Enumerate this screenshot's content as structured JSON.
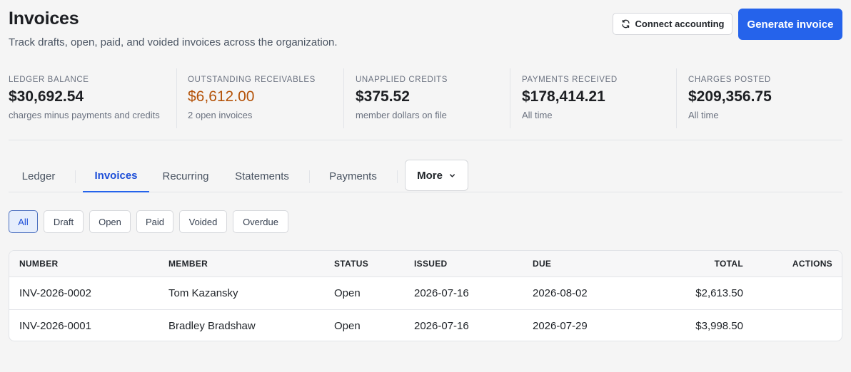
{
  "header": {
    "title": "Invoices",
    "subtitle": "Track drafts, open, paid, and voided invoices across the organization.",
    "connect_label": "Connect accounting",
    "generate_label": "Generate invoice"
  },
  "stats": [
    {
      "label": "LEDGER BALANCE",
      "value": "$30,692.54",
      "sub": "charges minus payments and credits"
    },
    {
      "label": "OUTSTANDING RECEIVABLES",
      "value": "$6,612.00",
      "sub": "2 open invoices",
      "value_color": "#b45309"
    },
    {
      "label": "UNAPPLIED CREDITS",
      "value": "$375.52",
      "sub": "member dollars on file"
    },
    {
      "label": "PAYMENTS RECEIVED",
      "value": "$178,414.21",
      "sub": "All time"
    },
    {
      "label": "CHARGES POSTED",
      "value": "$209,356.75",
      "sub": "All time"
    }
  ],
  "tabs": [
    {
      "label": "Ledger"
    },
    {
      "label": "Invoices",
      "active": true
    },
    {
      "label": "Recurring"
    },
    {
      "label": "Statements"
    },
    {
      "label": "Payments"
    }
  ],
  "more_label": "More",
  "filters": [
    {
      "label": "All",
      "active": true
    },
    {
      "label": "Draft"
    },
    {
      "label": "Open"
    },
    {
      "label": "Paid"
    },
    {
      "label": "Voided"
    },
    {
      "label": "Overdue"
    }
  ],
  "table": {
    "columns": [
      "NUMBER",
      "MEMBER",
      "STATUS",
      "ISSUED",
      "DUE",
      "TOTAL",
      "ACTIONS"
    ],
    "rows": [
      {
        "number": "INV-2026-0002",
        "member": "Tom Kazansky",
        "status": "Open",
        "issued": "2026-07-16",
        "due": "2026-08-02",
        "total": "$2,613.50"
      },
      {
        "number": "INV-2026-0001",
        "member": "Bradley Bradshaw",
        "status": "Open",
        "issued": "2026-07-16",
        "due": "2026-07-29",
        "total": "$3,998.50"
      }
    ]
  },
  "colors": {
    "accent": "#2563eb",
    "warning": "#b45309",
    "background": "#f5f5f5"
  },
  "icons": {
    "connect": "refresh-icon",
    "more": "chevron-down-icon"
  }
}
